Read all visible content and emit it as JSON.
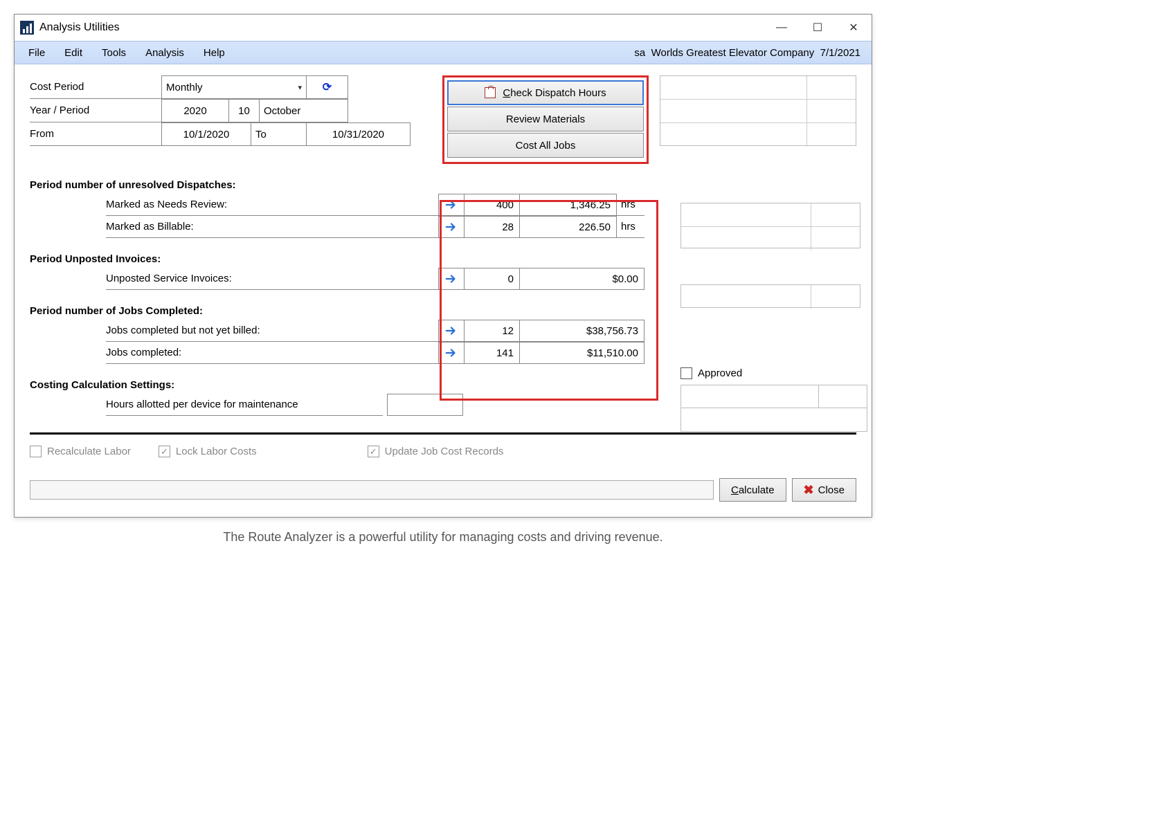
{
  "window": {
    "title": "Analysis Utilities"
  },
  "menu": {
    "file": "File",
    "edit": "Edit",
    "tools": "Tools",
    "analysis": "Analysis",
    "help": "Help"
  },
  "context": {
    "user": "sa",
    "company": "Worlds Greatest Elevator Company",
    "date": "7/1/2021"
  },
  "filters": {
    "cost_period_label": "Cost Period",
    "cost_period_value": "Monthly",
    "year_period_label": "Year / Period",
    "year": "2020",
    "period_num": "10",
    "period_month": "October",
    "from_label": "From",
    "from_date": "10/1/2020",
    "to_label": "To",
    "to_date": "10/31/2020"
  },
  "actions": {
    "check_dispatch": "Check Dispatch Hours",
    "review_materials": "Review Materials",
    "cost_all_jobs": "Cost All Jobs"
  },
  "sections": {
    "dispatches_h": "Period number of unresolved Dispatches:",
    "needs_review_label": "Marked as Needs Review:",
    "needs_review_count": "400",
    "needs_review_hours": "1,346.25",
    "billable_label": "Marked as Billable:",
    "billable_count": "28",
    "billable_hours": "226.50",
    "hrs_unit": "hrs",
    "invoices_h": "Period Unposted Invoices:",
    "unposted_label": "Unposted Service Invoices:",
    "unposted_count": "0",
    "unposted_amount": "$0.00",
    "jobs_h": "Period number of Jobs Completed:",
    "jobs_unbilled_label": "Jobs completed but not yet billed:",
    "jobs_unbilled_count": "12",
    "jobs_unbilled_amount": "$38,756.73",
    "jobs_completed_label": "Jobs completed:",
    "jobs_completed_count": "141",
    "jobs_completed_amount": "$11,510.00",
    "costing_h": "Costing Calculation Settings:",
    "hours_allotted_label": "Hours allotted per device for maintenance"
  },
  "approved_label": "Approved",
  "checks": {
    "recalc": "Recalculate Labor",
    "lock": "Lock Labor Costs",
    "update": "Update Job Cost Records"
  },
  "footer": {
    "calculate": "Calculate",
    "close": "Close"
  },
  "caption": "The Route Analyzer is a powerful utility for managing costs and driving revenue."
}
